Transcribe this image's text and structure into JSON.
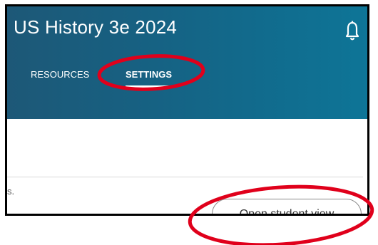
{
  "header": {
    "course_title": "US History 3e 2024",
    "bell_icon": "bell-icon"
  },
  "tabs": [
    {
      "label": "RESOURCES",
      "active": false
    },
    {
      "label": "SETTINGS",
      "active": true
    }
  ],
  "content": {
    "clipped_text": "s.",
    "open_student_view_label": "Open student view"
  },
  "colors": {
    "header_start": "#1d5877",
    "header_end": "#0e7597",
    "annotation_red": "#e0001b"
  }
}
